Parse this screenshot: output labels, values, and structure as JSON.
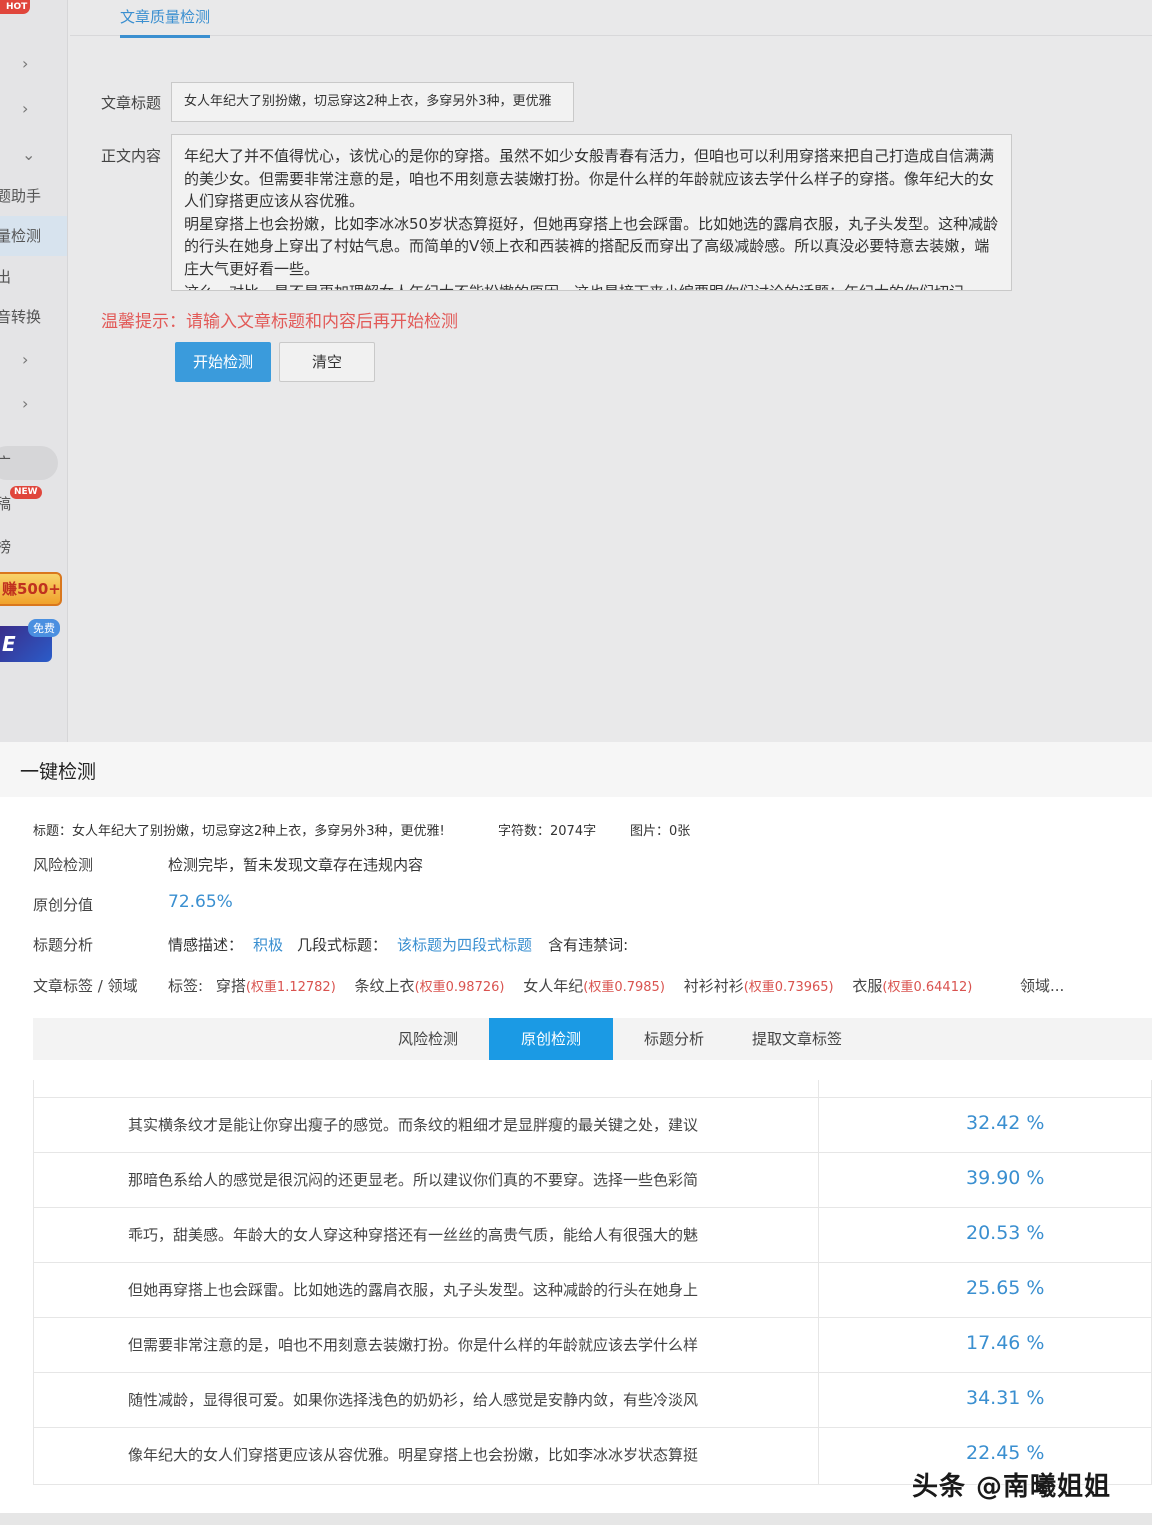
{
  "sidebar": {
    "hot_badge": "HOT",
    "items": [
      {
        "label": "题助手"
      },
      {
        "label": "量检测"
      },
      {
        "label": "出"
      },
      {
        "label": "音转换"
      },
      {
        "label": "广"
      },
      {
        "label": "稿"
      },
      {
        "label": "榜"
      }
    ],
    "new_badge": "NEW",
    "earn_banner": "赚500+",
    "free_badge": "免费"
  },
  "page": {
    "active_tab": "文章质量检测",
    "title_label": "文章标题",
    "title_value": "女人年纪大了别扮嫩，切忌穿这2种上衣，多穿另外3种，更优雅",
    "content_label": "正文内容",
    "content_paragraphs": [
      "年纪大了并不值得忧心，该忧心的是你的穿搭。虽然不如少女般青春有活力，但咱也可以利用穿搭来把自己打造成自信满满的美少女。但需要非常注意的是，咱也不用刻意去装嫩打扮。你是什么样的年龄就应该去学什么样子的穿搭。像年纪大的女人们穿搭更应该从容优雅。",
      "明星穿搭上也会扮嫩，比如李冰冰50岁状态算挺好，但她再穿搭上也会踩雷。比如她选的露肩衣服，丸子头发型。这种减龄的行头在她身上穿出了村姑气息。而简单的V领上衣和西装裤的搭配反而穿出了高级减龄感。所以真没必要特意去装嫩，端庄大气更好看一些。",
      "这么一对比，是不是更加理解女人年纪大不能扮嫩的原因，这也是接下来小编要跟你们讨论的话题：年纪大的你们切记"
    ],
    "tip": "温馨提示：请输入文章标题和内容后再开始检测",
    "start_button": "开始检测",
    "clear_button": "清空"
  },
  "modal": {
    "title": "一键检测",
    "meta": {
      "title_text": "标题：女人年纪大了别扮嫩，切忌穿这2种上衣，多穿另外3种，更优雅!",
      "word_count": "字符数：2074字",
      "images": "图片：0张"
    },
    "risk_label": "风险检测",
    "risk_value": "检测完毕，暂未发现文章存在违规内容",
    "original_label": "原创分值",
    "original_value": "72.65%",
    "title_analysis_label": "标题分析",
    "emotion_label": "情感描述：",
    "emotion_value": "积极",
    "segment_label": "几段式标题：",
    "segment_value": "该标题为四段式标题",
    "banned_label": "含有违禁词:",
    "tags_label": "文章标签 / 领域",
    "tags_prefix": "标签:",
    "tags": [
      {
        "name": "穿搭",
        "weight": "(权重1.12782)"
      },
      {
        "name": "条纹上衣",
        "weight": "(权重0.98726)"
      },
      {
        "name": "女人年纪",
        "weight": "(权重0.7985)"
      },
      {
        "name": "衬衫衬衫",
        "weight": "(权重0.73965)"
      },
      {
        "name": "衣服",
        "weight": "(权重0.64412)"
      }
    ],
    "domain": "领域...",
    "tabs": [
      "风险检测",
      "原创检测",
      "标题分析",
      "提取文章标签"
    ],
    "rows": [
      {
        "text": "其实横条纹才是能让你穿出瘦子的感觉。而条纹的粗细才是显胖瘦的最关键之处，建议",
        "percent": "32.42 %"
      },
      {
        "text": "那暗色系给人的感觉是很沉闷的还更显老。所以建议你们真的不要穿。选择一些色彩简",
        "percent": "39.90 %"
      },
      {
        "text": "乖巧，甜美感。年龄大的女人穿这种穿搭还有一丝丝的高贵气质，能给人有很强大的魅",
        "percent": "20.53 %"
      },
      {
        "text": "但她再穿搭上也会踩雷。比如她选的露肩衣服，丸子头发型。这种减龄的行头在她身上",
        "percent": "25.65 %"
      },
      {
        "text": "但需要非常注意的是，咱也不用刻意去装嫩打扮。你是什么样的年龄就应该去学什么样",
        "percent": "17.46 %"
      },
      {
        "text": "随性减龄，显得很可爱。如果你选择浅色的奶奶衫，给人感觉是安静内敛，有些冷淡风",
        "percent": "34.31 %"
      },
      {
        "text": "像年纪大的女人们穿搭更应该从容优雅。明星穿搭上也会扮嫩，比如李冰冰岁状态算挺",
        "percent": "22.45 %"
      }
    ]
  },
  "watermark": "头条 @南曦姐姐"
}
